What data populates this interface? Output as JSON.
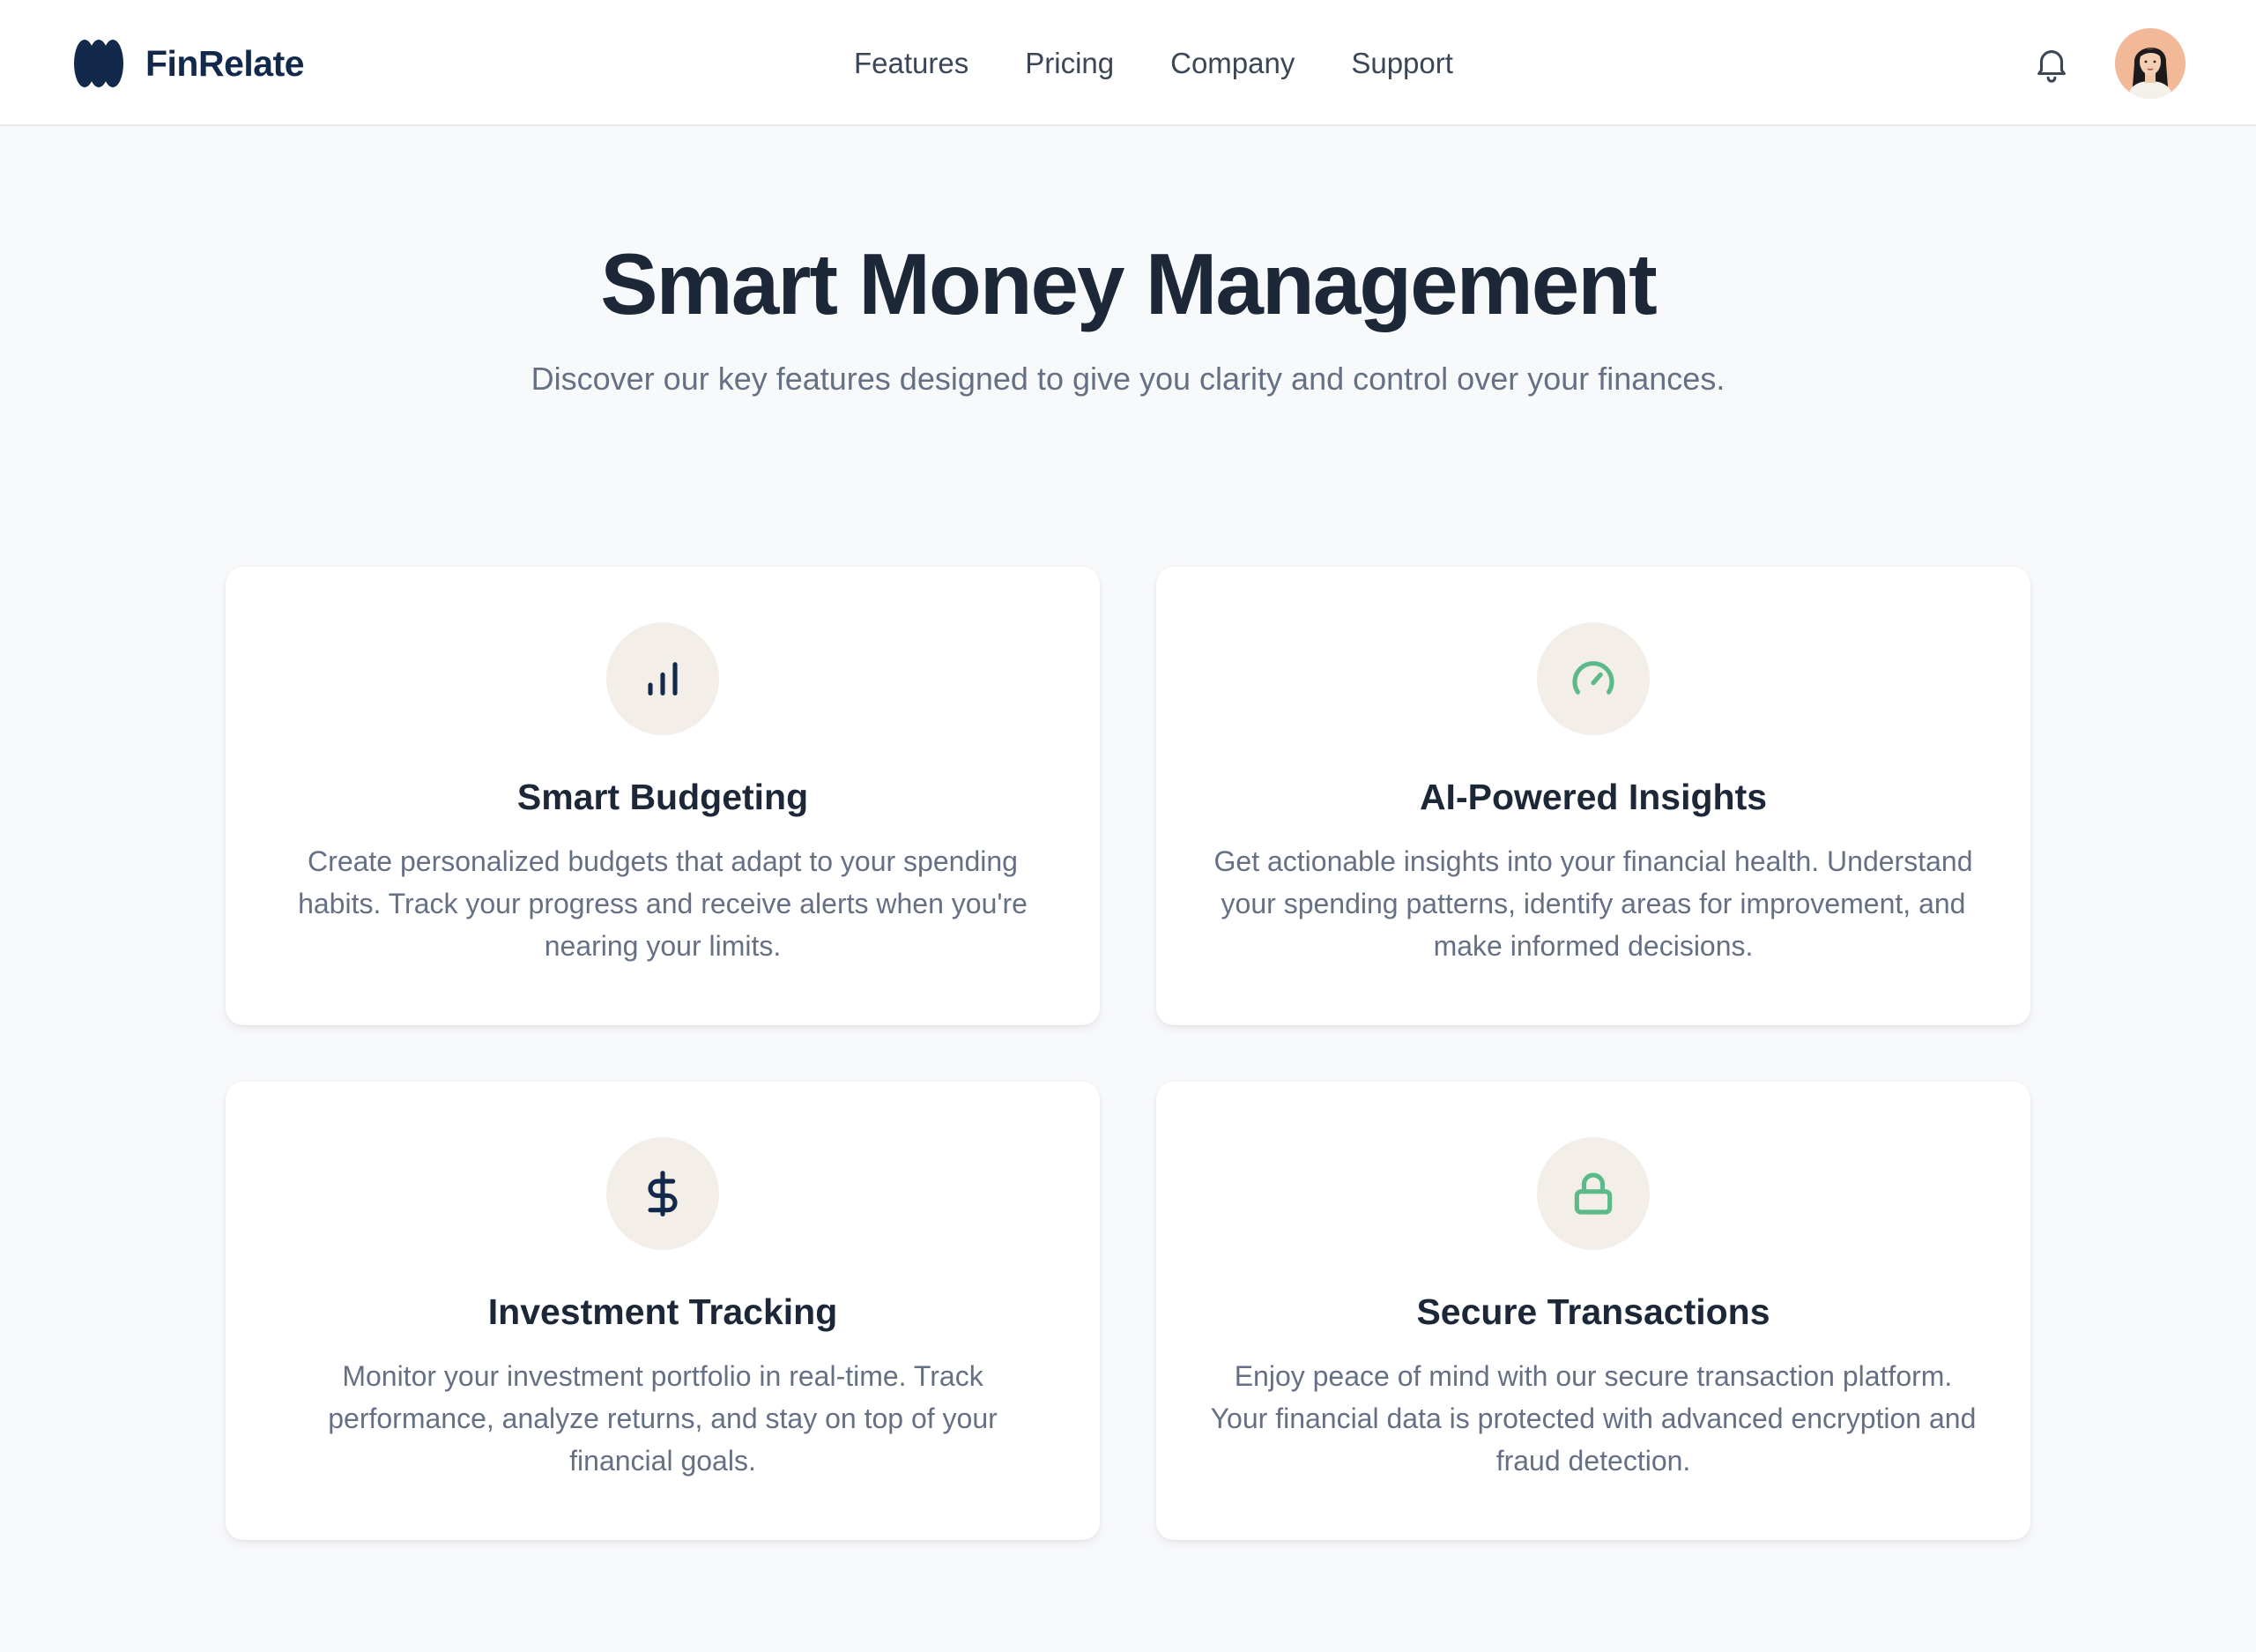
{
  "header": {
    "brand_name": "FinRelate",
    "logo_icon": "brand-logo-icon",
    "nav": [
      {
        "label": "Features"
      },
      {
        "label": "Pricing"
      },
      {
        "label": "Company"
      },
      {
        "label": "Support"
      }
    ],
    "notification_icon": "bell-icon",
    "avatar_icon": "user-avatar"
  },
  "hero": {
    "title": "Smart Money Management",
    "subtitle": "Discover our key features designed to give you clarity and control over your finances."
  },
  "features": [
    {
      "title": "Smart Budgeting",
      "description": "Create personalized budgets that adapt to your spending habits. Track your progress and receive alerts when you're nearing your limits.",
      "icon": "bar-chart-icon",
      "icon_color": "#13294b"
    },
    {
      "title": "AI-Powered Insights",
      "description": "Get actionable insights into your financial health. Understand your spending patterns, identify areas for improvement, and make informed decisions.",
      "icon": "gauge-icon",
      "icon_color": "#5bb98a"
    },
    {
      "title": "Investment Tracking",
      "description": "Monitor your investment portfolio in real-time. Track performance, analyze returns, and stay on top of your financial goals.",
      "icon": "dollar-icon",
      "icon_color": "#13294b"
    },
    {
      "title": "Secure Transactions",
      "description": "Enjoy peace of mind with our secure transaction platform. Your financial data is protected with advanced encryption and fraud detection.",
      "icon": "lock-icon",
      "icon_color": "#5bb98a"
    }
  ],
  "colors": {
    "brand": "#13294b",
    "accent_green": "#5bb98a",
    "icon_bg": "#f3efe8",
    "page_bg": "#f8f9fb"
  }
}
